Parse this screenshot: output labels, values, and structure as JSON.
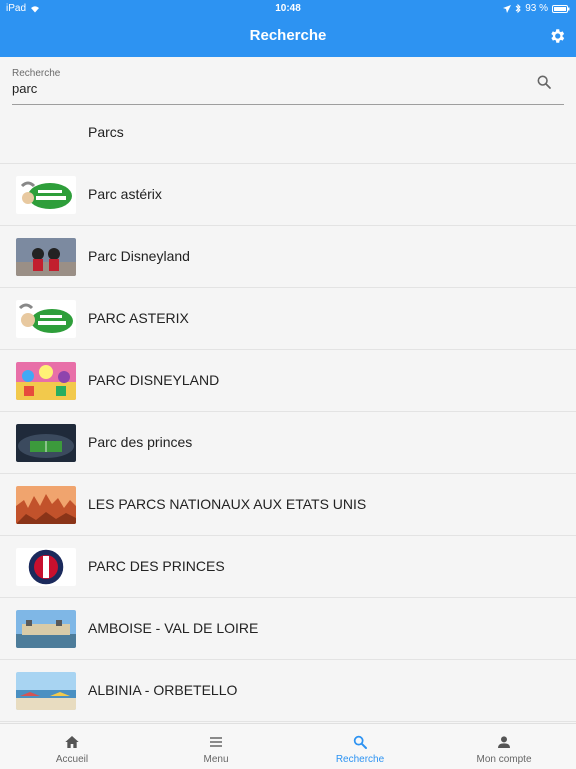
{
  "status": {
    "device": "iPad",
    "time": "10:48",
    "battery": "93 %"
  },
  "header": {
    "title": "Recherche"
  },
  "search": {
    "label": "Recherche",
    "value": "parc"
  },
  "results": [
    {
      "label": "Parcs"
    },
    {
      "label": "Parc astérix"
    },
    {
      "label": "Parc Disneyland"
    },
    {
      "label": "PARC ASTERIX"
    },
    {
      "label": "PARC DISNEYLAND"
    },
    {
      "label": "Parc des princes"
    },
    {
      "label": "LES PARCS NATIONAUX AUX ETATS UNIS"
    },
    {
      "label": "PARC DES PRINCES"
    },
    {
      "label": "AMBOISE - VAL DE LOIRE"
    },
    {
      "label": "ALBINIA - ORBETELLO"
    }
  ],
  "tabs": [
    {
      "label": "Accueil",
      "icon": "home-icon"
    },
    {
      "label": "Menu",
      "icon": "menu-icon"
    },
    {
      "label": "Recherche",
      "icon": "search-icon",
      "active": true
    },
    {
      "label": "Mon compte",
      "icon": "account-icon"
    }
  ],
  "colors": {
    "accent": "#2d93f2"
  }
}
